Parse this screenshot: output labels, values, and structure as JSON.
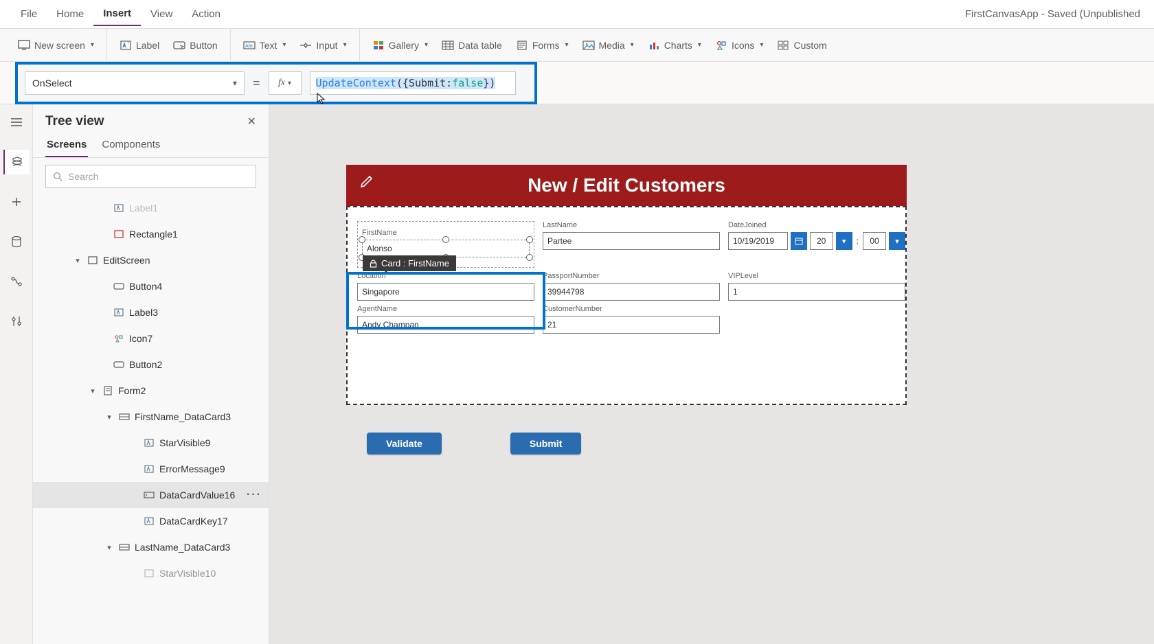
{
  "app_title": "FirstCanvasApp - Saved (Unpublished",
  "menu": {
    "file": "File",
    "home": "Home",
    "insert": "Insert",
    "view": "View",
    "action": "Action"
  },
  "ribbon": {
    "new_screen": "New screen",
    "label": "Label",
    "button": "Button",
    "text": "Text",
    "input": "Input",
    "gallery": "Gallery",
    "data_table": "Data table",
    "forms": "Forms",
    "media": "Media",
    "charts": "Charts",
    "icons": "Icons",
    "custom": "Custom"
  },
  "formula": {
    "property": "OnSelect",
    "fx": "fx",
    "fn": "UpdateContext",
    "open": "({",
    "key": "Submit:",
    "val": "false",
    "close": "})"
  },
  "tree": {
    "title": "Tree view",
    "tab_screens": "Screens",
    "tab_components": "Components",
    "search_placeholder": "Search",
    "nodes": {
      "label1": "Label1",
      "rect1": "Rectangle1",
      "editscreen": "EditScreen",
      "button4": "Button4",
      "label3": "Label3",
      "icon7": "Icon7",
      "button2": "Button2",
      "form2": "Form2",
      "firstname_dc": "FirstName_DataCard3",
      "starvis9": "StarVisible9",
      "errmsg9": "ErrorMessage9",
      "dcv16": "DataCardValue16",
      "dck17": "DataCardKey17",
      "lastname_dc": "LastName_DataCard3",
      "starvis10": "StarVisible10"
    }
  },
  "canvas": {
    "header": "New / Edit Customers",
    "card_badge": "Card : FirstName",
    "fields": {
      "firstname_l": "FirstName",
      "firstname_v": "Alonso",
      "lastname_l": "LastName",
      "lastname_v": "Partee",
      "datejoined_l": "DateJoined",
      "datejoined_v": "10/19/2019",
      "hour": "20",
      "minute": "00",
      "location_l": "Location",
      "location_v": "Singapore",
      "passport_l": "PassportNumber",
      "passport_v": "39944798",
      "viplevel_l": "VIPLevel",
      "viplevel_v": "1",
      "agent_l": "AgentName",
      "agent_v": "Andy Champan",
      "custnum_l": "CustomerNumber",
      "custnum_v": "21"
    },
    "validate_btn": "Validate",
    "submit_btn": "Submit"
  }
}
